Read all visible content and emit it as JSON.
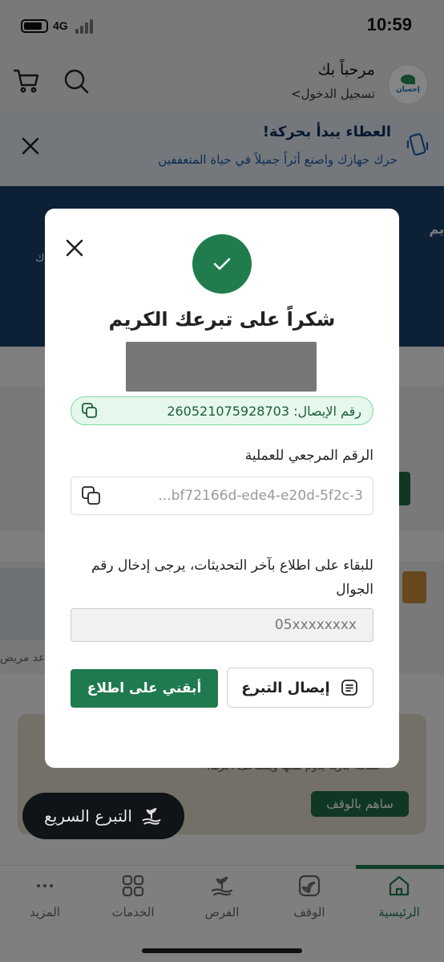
{
  "status_bar": {
    "time": "10:59",
    "network": "4G"
  },
  "header": {
    "welcome": "مرحباً بك",
    "login_link": "تسجيل الدخول>",
    "logo_text": "إحسان"
  },
  "promo": {
    "title": "العطاء يبدأ بحركة!",
    "subtitle": "حرك جهازك واصنع أثراً جميلاً في حياة المتعففين"
  },
  "background": {
    "hero_text_1": "يم",
    "hero_text_2": "ك",
    "card_text": "عد مريض",
    "card2_text": "صدقة جارية يدوم نفعها ويتضاعف أجرها.",
    "card2_button": "ساهم بالوقف"
  },
  "quick_donate": {
    "label": "التبرع السريع"
  },
  "tabs": [
    {
      "label": "الرئيسية",
      "icon": "home-icon",
      "active": true
    },
    {
      "label": "الوقف",
      "icon": "leaf-box-icon",
      "active": false
    },
    {
      "label": "الفرص",
      "icon": "hand-plant-icon",
      "active": false
    },
    {
      "label": "الخدمات",
      "icon": "grid-icon",
      "active": false
    },
    {
      "label": "المزيد",
      "icon": "more-dots-icon",
      "active": false
    }
  ],
  "modal": {
    "title": "شكراً على تبرعك الكريم",
    "receipt_number": "رقم الإيصال: 260521075928703",
    "reference_label": "الرقم المرجعي للعملية",
    "reference_value": "...bf72166d-ede4-e20d-5f2c-3",
    "info_text": "للبقاء على اطلاع بآخر التحديثات، يرجى إدخال رقم الجوال",
    "phone_placeholder": "05xxxxxxxx",
    "keep_updated_button": "أبقني على اطلاع",
    "receipt_button": "إيصال التبرع"
  },
  "colors": {
    "brand_green": "#1f7a50",
    "dark_navy": "#1a4068",
    "receipt_bg": "#e6f7ec"
  }
}
